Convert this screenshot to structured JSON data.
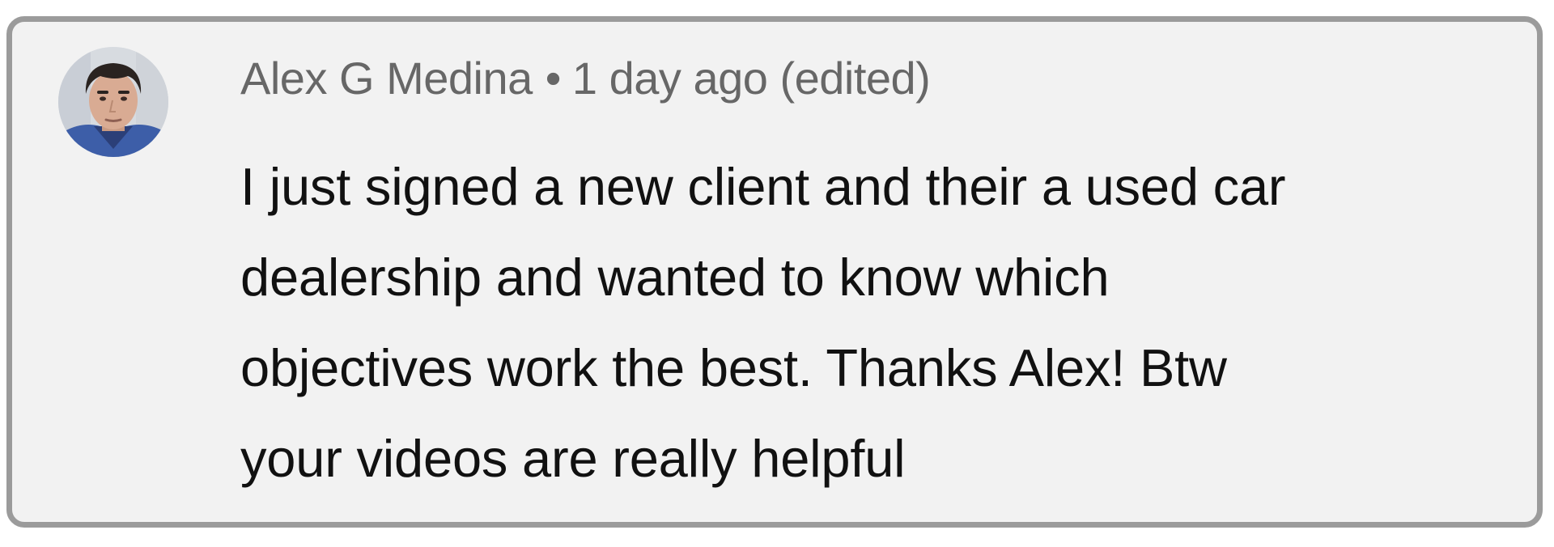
{
  "comment": {
    "author": "Alex G Medina",
    "separator": "•",
    "timestamp": "1 day ago",
    "edited": "(edited)",
    "text_lines": [
      "I just signed a new client and their a used car",
      "dealership and wanted to know which",
      "objectives work the best. Thanks Alex! Btw",
      "your videos are really helpful"
    ],
    "avatar_icon": "user-avatar-photo"
  },
  "colors": {
    "card_background": "#f2f2f2",
    "card_border": "#9b9b9b",
    "meta_text": "#676767",
    "body_text": "#111111"
  }
}
